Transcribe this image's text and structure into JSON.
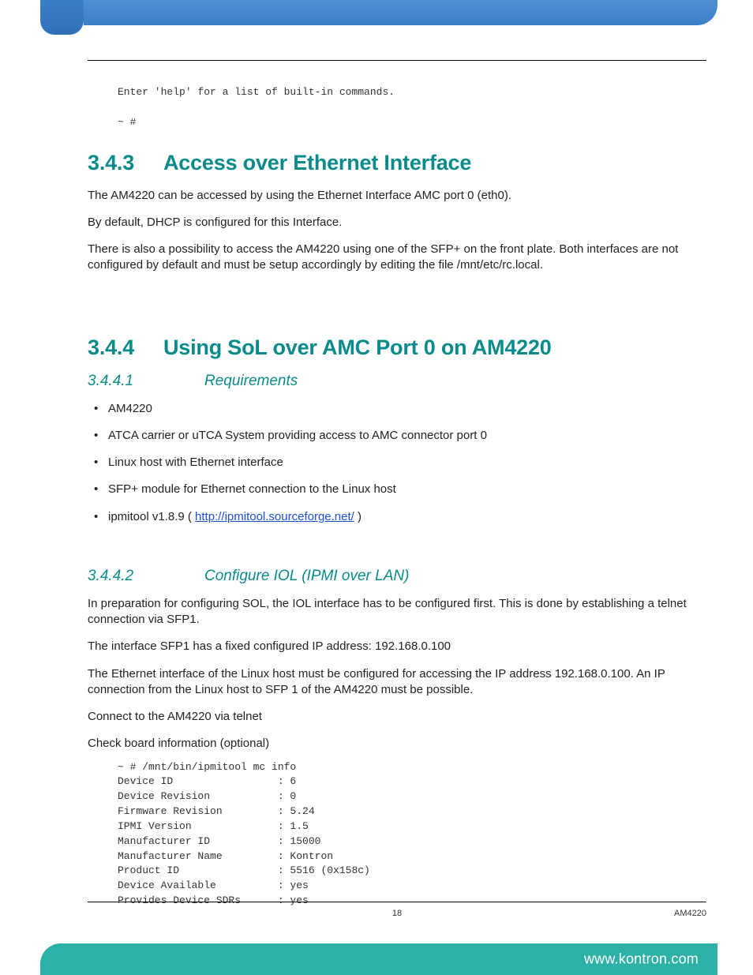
{
  "pre_top": "Enter 'help' for a list of built-in commands.\n\n~ #",
  "sec343": {
    "num": "3.4.3",
    "title": "Access over Ethernet Interface"
  },
  "p343_1": "The AM4220 can be accessed by using the Ethernet Interface AMC port 0 (eth0).",
  "p343_2": "By default, DHCP is configured for this Interface.",
  "p343_3": "There is also a possibility to access the AM4220 using one of the SFP+ on the front plate. Both interfaces are not configured by default and must be setup accordingly by editing the file /mnt/etc/rc.local.",
  "sec344": {
    "num": "3.4.4",
    "title": "Using SoL over AMC Port 0 on  AM4220"
  },
  "sub3441": {
    "num": "3.4.4.1",
    "title": "Requirements"
  },
  "req": {
    "i0": "AM4220",
    "i1": "ATCA carrier or uTCA System providing access to AMC connector port 0",
    "i2": "Linux host with Ethernet interface",
    "i3": "SFP+ module for Ethernet connection to the Linux host",
    "i4_pre": "ipmitool v1.8.9 ( ",
    "i4_link": "http://ipmitool.sourceforge.net/",
    "i4_post": " )"
  },
  "sub3442": {
    "num": "3.4.4.2",
    "title": "Configure IOL (IPMI over LAN)"
  },
  "p3442_1": "In preparation for configuring SOL, the IOL interface has to be configured first. This is done by establishing a telnet connection via SFP1.",
  "p3442_2": "The interface SFP1 has a fixed configured IP address: 192.168.0.100",
  "p3442_3": "The Ethernet interface of the Linux host must be configured for accessing the IP address 192.168.0.100. An IP connection from the Linux host to SFP 1 of the AM4220 must be possible.",
  "p3442_4": "Connect to the AM4220 via telnet",
  "p3442_5": "Check board information (optional)",
  "pre_info": "~ # /mnt/bin/ipmitool mc info\nDevice ID                 : 6\nDevice Revision           : 0\nFirmware Revision         : 5.24\nIPMI Version              : 1.5\nManufacturer ID           : 15000\nManufacturer Name         : Kontron\nProduct ID                : 5516 (0x158c)\nDevice Available          : yes\nProvides Device SDRs      : yes",
  "footer": {
    "page": "18",
    "product": "AM4220",
    "url": "www.kontron.com"
  }
}
